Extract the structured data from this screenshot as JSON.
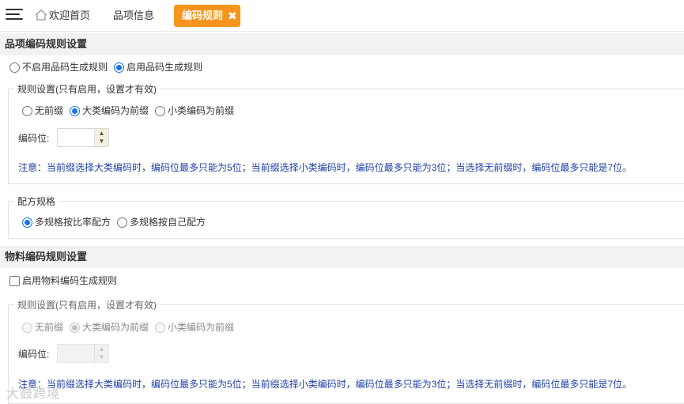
{
  "tabs": {
    "home": "欢迎首页",
    "item_info": "品项信息",
    "active": "编码规则",
    "close": "✖"
  },
  "item_section": {
    "title": "品项编码规则设置",
    "enable_options": [
      {
        "label": "不启用品码生成规则",
        "checked": false
      },
      {
        "label": "启用品码生成规则",
        "checked": true
      }
    ],
    "rule_group": {
      "legend": "规则设置(只有启用，设置才有效)",
      "prefix_options": [
        {
          "label": "无前缀",
          "checked": false
        },
        {
          "label": "大类编码为前缀",
          "checked": true
        },
        {
          "label": "小类编码为前缀",
          "checked": false
        }
      ],
      "code_digits_label": "编码位:",
      "code_digits_value": "",
      "note": "注意：当前缀选择大类编码时，编码位最多只能为5位；当前缀选择小类编码时，编码位最多只能为3位；当选择无前缀时，编码位最多只能是7位。"
    },
    "formula_group": {
      "legend": "配方规格",
      "options": [
        {
          "label": "多规格按比率配方",
          "checked": true
        },
        {
          "label": "多规格按自己配方",
          "checked": false
        }
      ]
    }
  },
  "material_section": {
    "title": "物料编码规则设置",
    "enable_checkbox": {
      "label": "启用物料编码生成规则",
      "checked": false
    },
    "rule_group": {
      "legend": "规则设置(只有启用，设置才有效)",
      "prefix_options": [
        {
          "label": "无前缀",
          "checked": false
        },
        {
          "label": "大类编码为前缀",
          "checked": true
        },
        {
          "label": "小类编码为前缀",
          "checked": false
        }
      ],
      "code_digits_label": "编码位:",
      "code_digits_value": "",
      "note": "注意：当前缀选择大类编码时，编码位最多只能为5位；当前缀选择小类编码时，编码位最多只能为3位；当选择无前缀时，编码位最多只能是7位。"
    }
  },
  "watermark": "大鼓跨境",
  "colors": {
    "active_tab": "#f7941d",
    "radio_checked": "#1a73e8",
    "note_text": "#1f3fa8",
    "section_header_bg": "#f2f2f2"
  },
  "icons": {
    "menu": "hamburger-icon",
    "home": "home-icon",
    "spin_up": "chevron-up-icon",
    "spin_down": "chevron-down-icon"
  }
}
